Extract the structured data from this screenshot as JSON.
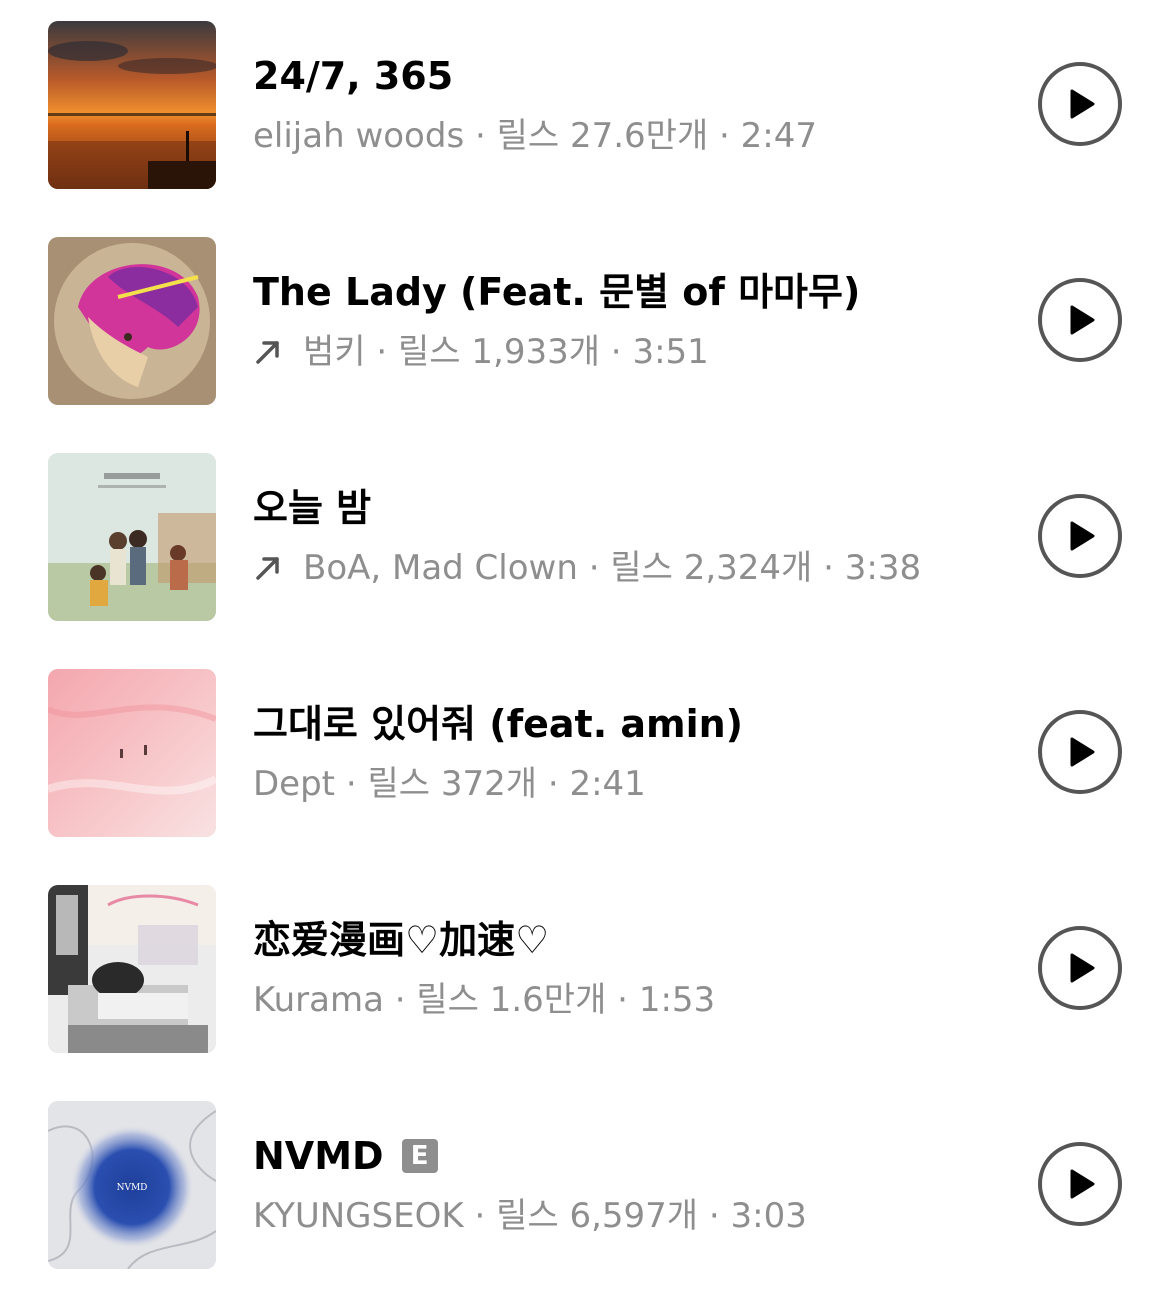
{
  "tracks": [
    {
      "title": "24/7, 365",
      "artist": "elijah woods",
      "reels_label": "릴스",
      "reels_count": "27.6만개",
      "duration": "2:47",
      "trending": false,
      "explicit": false,
      "art": "sunset-lake-cover"
    },
    {
      "title": "The Lady (Feat. 문별 of 마마무)",
      "artist": "범키",
      "reels_label": "릴스",
      "reels_count": "1,933개",
      "duration": "3:51",
      "trending": true,
      "explicit": false,
      "art": "illustrated-portrait-cover"
    },
    {
      "title": "오늘 밤",
      "artist": "BoA, Mad Clown",
      "reels_label": "릴스",
      "reels_count": "2,324개",
      "duration": "3:38",
      "trending": true,
      "explicit": false,
      "art": "drama-ost-cover"
    },
    {
      "title": "그대로 있어줘 (feat. amin)",
      "artist": "Dept",
      "reels_label": "릴스",
      "reels_count": "372개",
      "duration": "2:41",
      "trending": false,
      "explicit": false,
      "art": "pink-field-cover"
    },
    {
      "title": "恋爱漫画♡加速♡",
      "artist": "Kurama",
      "reels_label": "릴스",
      "reels_count": "1.6만개",
      "duration": "1:53",
      "trending": false,
      "explicit": false,
      "art": "manga-classroom-cover"
    },
    {
      "title": "NVMD",
      "artist": "KYUNGSEOK",
      "reels_label": "릴스",
      "reels_count": "6,597개",
      "duration": "3:03",
      "trending": false,
      "explicit": true,
      "explicit_label": "E",
      "art": "blue-blur-cover",
      "art_text": "NVMD"
    }
  ],
  "separator": " · ",
  "icons": {
    "play": "play-circle-icon",
    "trend": "trending-arrow-icon"
  },
  "colors": {
    "title": "#000000",
    "meta": "#8e8e8e",
    "play_ring": "#555555",
    "badge": "#8e8e8e"
  }
}
